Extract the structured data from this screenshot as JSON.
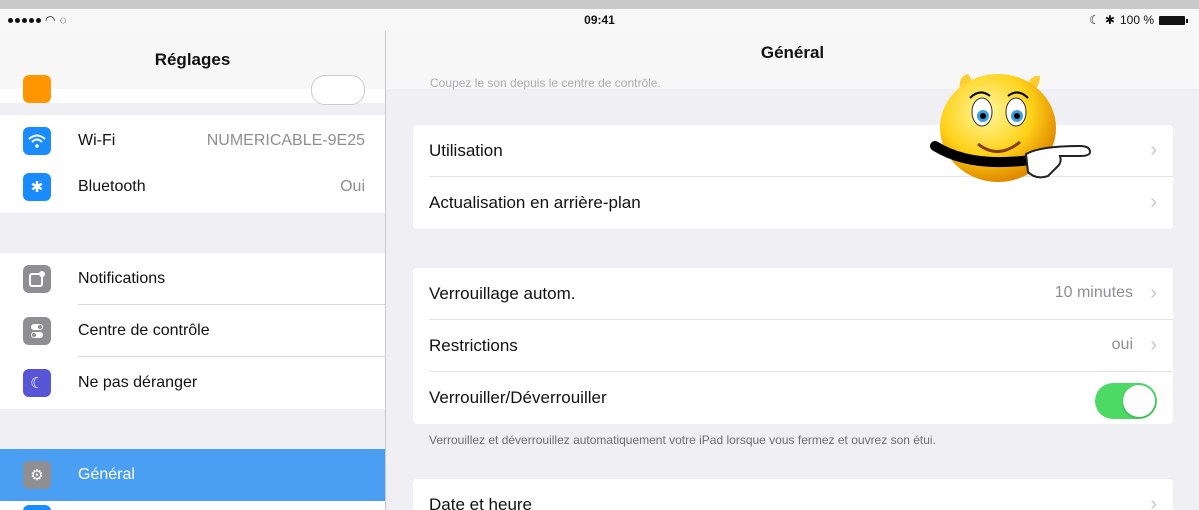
{
  "statusbar": {
    "time": "09:41",
    "battery": "100 %",
    "moon": "☾",
    "bluetooth": "✱"
  },
  "sidebar": {
    "title": "Réglages",
    "items": [
      {
        "label": "Wi-Fi",
        "value": "NUMERICABLE-9E25",
        "icon_color": "#1a8cff",
        "icon": "wifi-icon"
      },
      {
        "label": "Bluetooth",
        "value": "Oui",
        "icon_color": "#1a8cff",
        "icon": "bluetooth-icon"
      },
      {
        "label": "Notifications",
        "value": "",
        "icon_color": "#8e8e93",
        "icon": "notifications-icon"
      },
      {
        "label": "Centre de contrôle",
        "value": "",
        "icon_color": "#8e8e93",
        "icon": "control-center-icon"
      },
      {
        "label": "Ne pas déranger",
        "value": "",
        "icon_color": "#5856d6",
        "icon": "moon-icon"
      },
      {
        "label": "Général",
        "value": "",
        "icon_color": "#8e8e93",
        "icon": "gear-icon",
        "selected": true
      }
    ]
  },
  "main": {
    "title": "Général",
    "ghost_text": "Coupez le son depuis le centre de contrôle.",
    "group1": [
      {
        "label": "Utilisation"
      },
      {
        "label": "Actualisation en arrière-plan"
      }
    ],
    "group2": [
      {
        "label": "Verrouillage autom.",
        "value": "10 minutes"
      },
      {
        "label": "Restrictions",
        "value": "oui"
      },
      {
        "label": "Verrouiller/Déverrouiller",
        "toggle": true
      }
    ],
    "footnote": "Verrouillez et déverrouillez automatiquement votre iPad lorsque vous fermez et ouvrez son étui.",
    "group3": [
      {
        "label": "Date et heure"
      }
    ]
  },
  "colors": {
    "accent_selected": "#4a9ff2",
    "toggle_on": "#4cd964"
  }
}
